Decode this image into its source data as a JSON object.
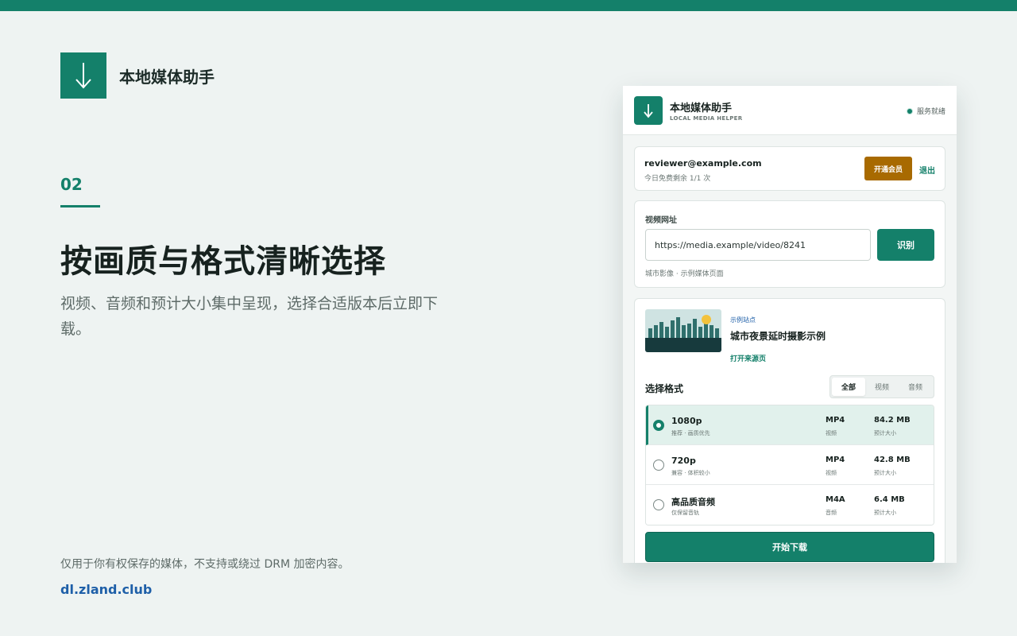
{
  "brand": {
    "name": "本地媒体助手",
    "icon": "download-arrow-icon"
  },
  "hero": {
    "step": "02",
    "title": "按画质与格式清晰选择",
    "subtitle": "视频、音频和预计大小集中呈现，选择合适版本后立即下载。"
  },
  "footer": {
    "disclaimer": "仅用于你有权保存的媒体，不支持或绕过 DRM 加密内容。",
    "link": "dl.zland.club"
  },
  "panel": {
    "title": "本地媒体助手",
    "subtitle": "LOCAL MEDIA HELPER",
    "status": "服务就绪",
    "account": {
      "email": "reviewer@example.com",
      "quota": "今日免费剩余 1/1 次",
      "vip_label": "开通会员",
      "logout_label": "退出"
    },
    "url": {
      "label": "视频网址",
      "value": "https://media.example/video/8241",
      "detect_label": "识别",
      "hint": "城市影像 · 示例媒体页面"
    },
    "media": {
      "site": "示例站点",
      "title": "城市夜景延时摄影示例",
      "open_source": "打开来源页"
    },
    "formats": {
      "label": "选择格式",
      "tabs": [
        "全部",
        "视频",
        "音频"
      ],
      "active_tab": "全部",
      "size_label": "预计大小",
      "rows": [
        {
          "quality": "1080p",
          "note": "推荐 · 画质优先",
          "format": "MP4",
          "kind": "视频",
          "size": "84.2 MB",
          "selected": true
        },
        {
          "quality": "720p",
          "note": "兼容 · 体积较小",
          "format": "MP4",
          "kind": "视频",
          "size": "42.8 MB",
          "selected": false
        },
        {
          "quality": "高品质音频",
          "note": "仅保留音轨",
          "format": "M4A",
          "kind": "音频",
          "size": "6.4 MB",
          "selected": false
        }
      ]
    },
    "download_label": "开始下载"
  },
  "colors": {
    "accent": "#14806a",
    "vip": "#a86a00",
    "link": "#1e5fa8",
    "background": "#eef3f2"
  }
}
